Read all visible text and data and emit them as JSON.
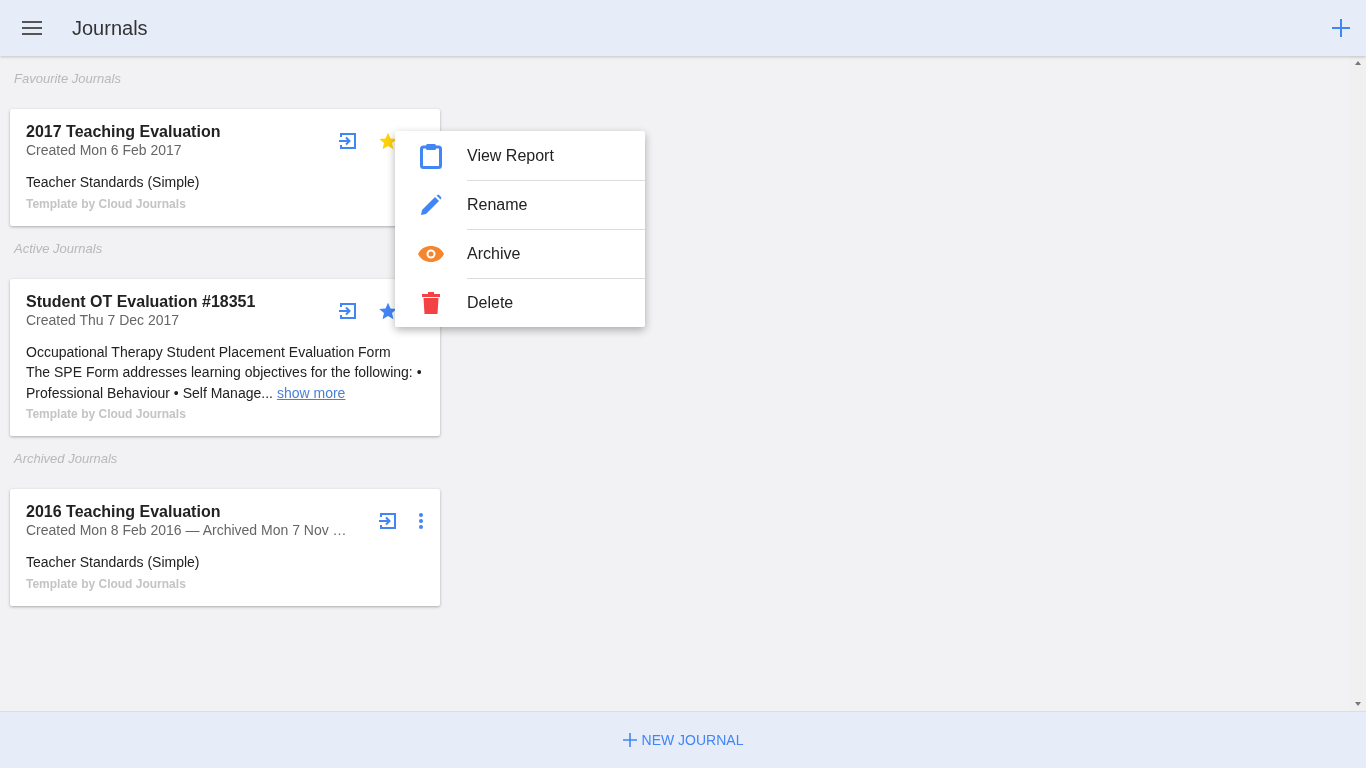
{
  "app_bar": {
    "title": "Journals"
  },
  "sections": [
    {
      "heading": "Favourite Journals",
      "cards": [
        {
          "title": "2017 Teaching Evaluation",
          "subtitle": "Created Mon 6 Feb 2017",
          "description": [
            "Teacher Standards (Simple)"
          ],
          "template": "Template by Cloud Journals",
          "favourite": true
        }
      ]
    },
    {
      "heading": "Active Journals",
      "cards": [
        {
          "title": "Student OT Evaluation #18351",
          "subtitle": "Created Thu 7 Dec 2017",
          "description": [
            "Occupational Therapy Student Placement Evaluation Form",
            "The SPE Form addresses learning objectives for the following: • Professional Behaviour • Self Manage..."
          ],
          "show_more": "show more",
          "template": "Template by Cloud Journals",
          "favourite": false
        }
      ]
    },
    {
      "heading": "Archived Journals",
      "cards": [
        {
          "title": "2016 Teaching Evaluation",
          "subtitle": "Created Mon 8 Feb 2016 — Archived Mon 7 Nov …",
          "description": [
            "Teacher Standards (Simple)"
          ],
          "template": "Template by Cloud Journals"
        }
      ]
    }
  ],
  "menu": [
    {
      "label": "View Report",
      "kind": "report",
      "color": "#4285f4"
    },
    {
      "label": "Rename",
      "kind": "rename",
      "color": "#4285f4"
    },
    {
      "label": "Archive",
      "kind": "archive",
      "color": "#f5862e"
    },
    {
      "label": "Delete",
      "kind": "delete",
      "color": "#f44242"
    }
  ],
  "footer": {
    "button": "NEW JOURNAL"
  }
}
